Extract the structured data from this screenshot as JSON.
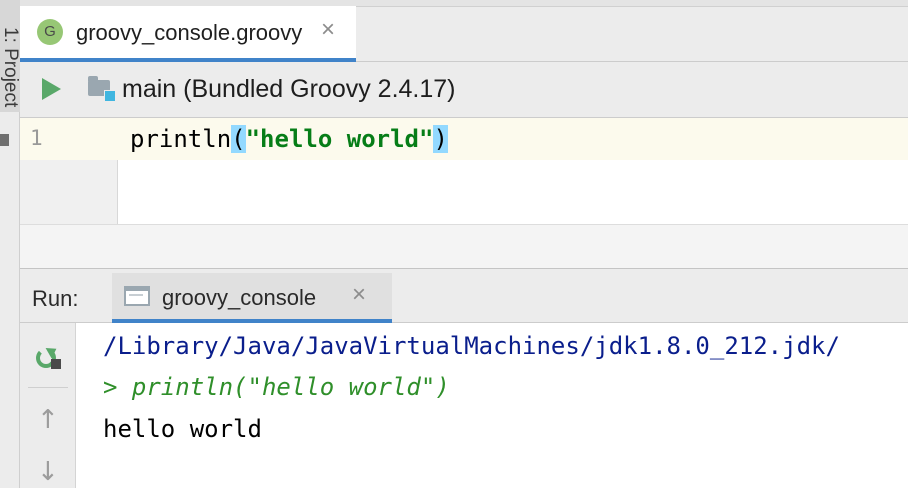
{
  "tool_strip": {
    "project_tab": "1: Project"
  },
  "editor_tab": {
    "icon_letter": "G",
    "label": "groovy_console.groovy",
    "close": "×"
  },
  "run_toolbar": {
    "configuration": "main (Bundled Groovy 2.4.17)"
  },
  "editor": {
    "line_number": "1",
    "code": {
      "call": "println",
      "open_paren": "(",
      "string": "\"hello world\"",
      "close_paren": ")"
    }
  },
  "run_window": {
    "label": "Run:",
    "tab": {
      "label": "groovy_console",
      "close": "×"
    },
    "toolbar": {
      "up_arrow": "↑",
      "down_arrow": "↓"
    },
    "console": {
      "command": "/Library/Java/JavaVirtualMachines/jdk1.8.0_212.jdk/",
      "echo": "> println(\"hello world\")",
      "output": "hello world"
    }
  },
  "colors": {
    "accent_tab_underline": "#4083c9",
    "run_green": "#59a869",
    "string_green": "#067d17",
    "brace_highlight": "#93d9ff",
    "console_command_blue": "#0a1e8c",
    "console_echo_green": "#2f8f2a"
  },
  "icons": {
    "run": "run-icon",
    "module": "module-folder-icon",
    "rerun": "rerun-icon",
    "file": "groovy-file-icon",
    "console_tab": "console-icon"
  }
}
